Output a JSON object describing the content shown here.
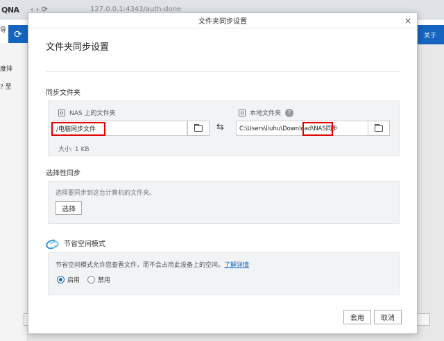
{
  "background": {
    "logo": "QNA",
    "url_text": "127.0.0.1:4343/auth-done",
    "nav_symbols": "‹  ›  ⟳",
    "left_snippets": [
      "导",
      "度排",
      "? 至"
    ],
    "right_button_label": "关于"
  },
  "dialog": {
    "window_title": "文件夹同步设置",
    "heading": "文件夹同步设置",
    "close_symbol": "×"
  },
  "sync_folder": {
    "section_title": "同步文件夹",
    "nas_label": "NAS 上的文件夹",
    "nas_path": "/电脑同步文件",
    "local_label": "本地文件夹",
    "local_path": "C:\\Users\\liuhu\\Download\\NAS同步",
    "size_text": "大小: 1 KB",
    "help_symbol": "?",
    "swap_symbol": "⇆"
  },
  "selective_sync": {
    "section_title": "选择性同步",
    "hint": "选择要同步到这台计算机的文件夹。",
    "select_button": "选择"
  },
  "space_saving": {
    "section_title": "节省空间模式",
    "description": "节省空间模式允许您查看文件，而不会占用此设备上的空间。",
    "learn_more": "了解详情",
    "option_enable": "启用",
    "option_disable": "禁用",
    "selected": "启用"
  },
  "footer": {
    "apply_button": "套用",
    "cancel_button": "取消"
  },
  "colors": {
    "accent": "#1565c0",
    "highlight_box": "#e00000"
  }
}
